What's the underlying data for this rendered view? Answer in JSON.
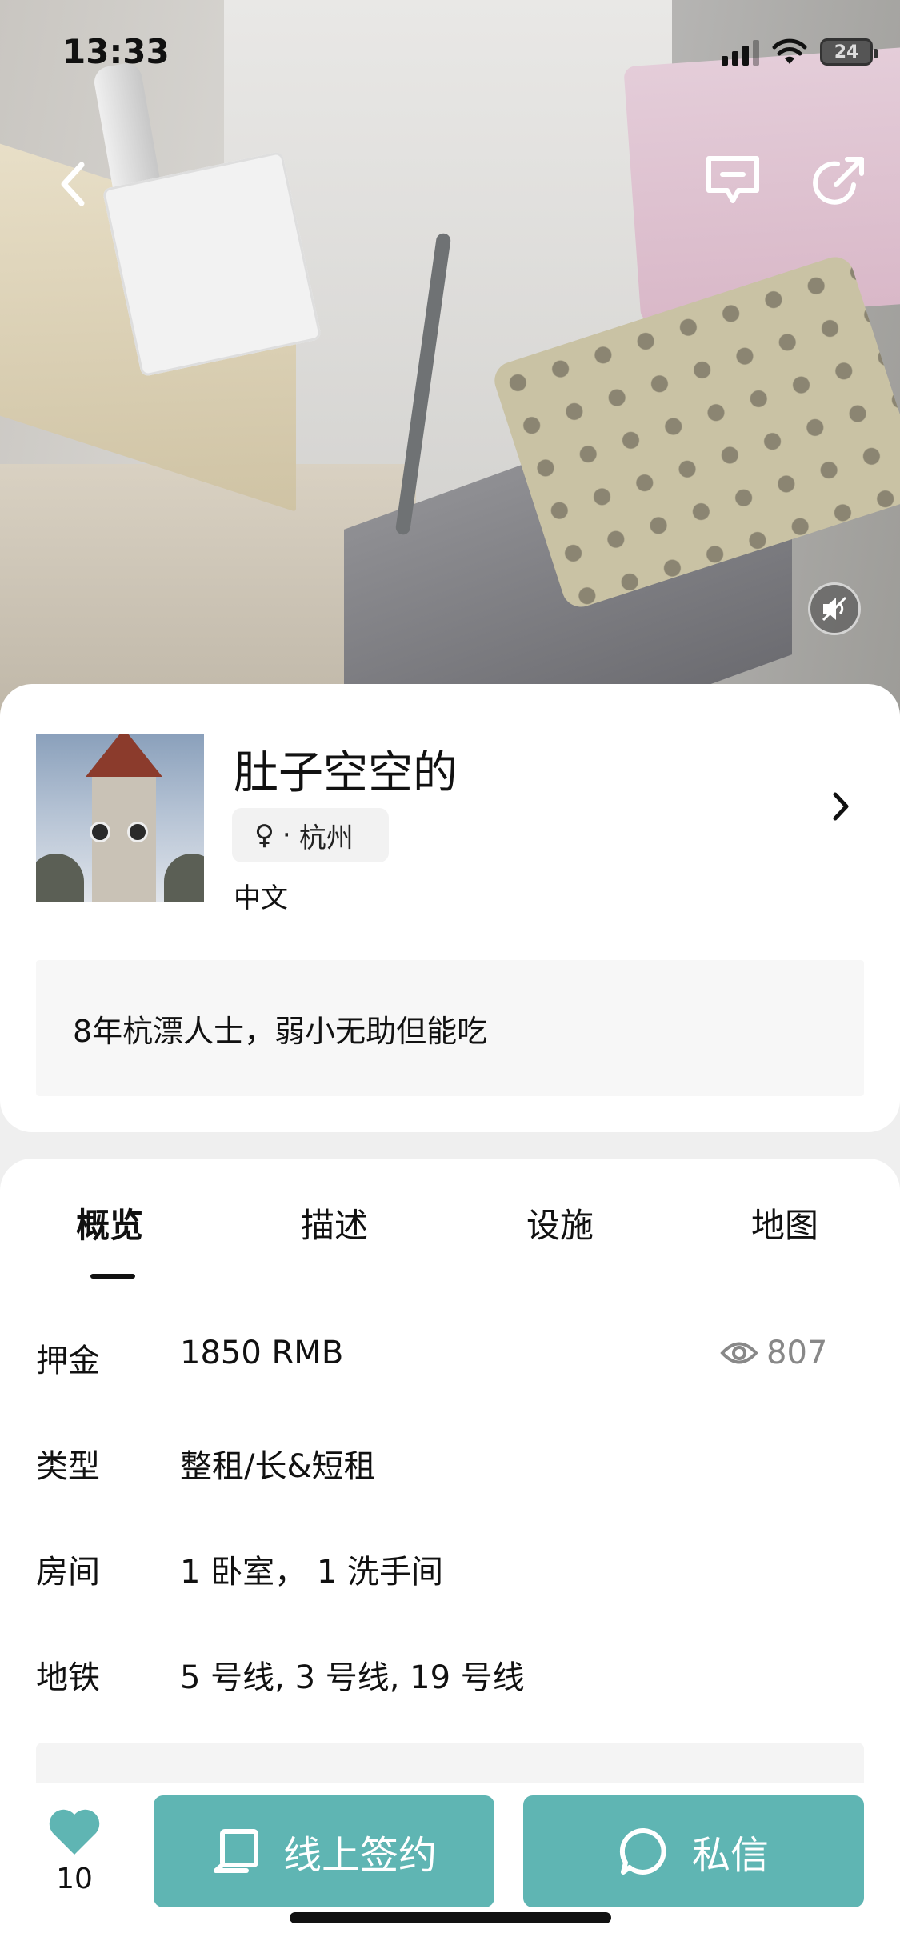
{
  "status_bar": {
    "time": "13:33",
    "battery": "24"
  },
  "hero": {
    "back_icon": "chevron-left-icon",
    "comment_icon": "message-icon",
    "share_icon": "share-icon",
    "mute_icon": "speaker-muted-icon"
  },
  "host": {
    "name": "肚子空空的",
    "gender_symbol": "♀",
    "tag_sep": "·",
    "city": "杭州",
    "language": "中文",
    "bio": "8年杭漂人士，弱小无助但能吃"
  },
  "tabs": [
    {
      "label": "概览",
      "active": true
    },
    {
      "label": "描述",
      "active": false
    },
    {
      "label": "设施",
      "active": false
    },
    {
      "label": "地图",
      "active": false
    }
  ],
  "overview": {
    "deposit_label": "押金",
    "deposit_value": "1850 RMB",
    "views": "807",
    "type_label": "类型",
    "type_value": "整租/长&短租",
    "rooms_label": "房间",
    "rooms_value": "1 卧室，  1 洗手间",
    "metro_label": "地铁",
    "metro_value": "5 号线, 3 号线, 19 号线"
  },
  "bottom_bar": {
    "favorites_count": "10",
    "sign_label": "线上签约",
    "message_label": "私信"
  },
  "colors": {
    "accent": "#5fb5b3",
    "heart": "#5fb5b3"
  }
}
